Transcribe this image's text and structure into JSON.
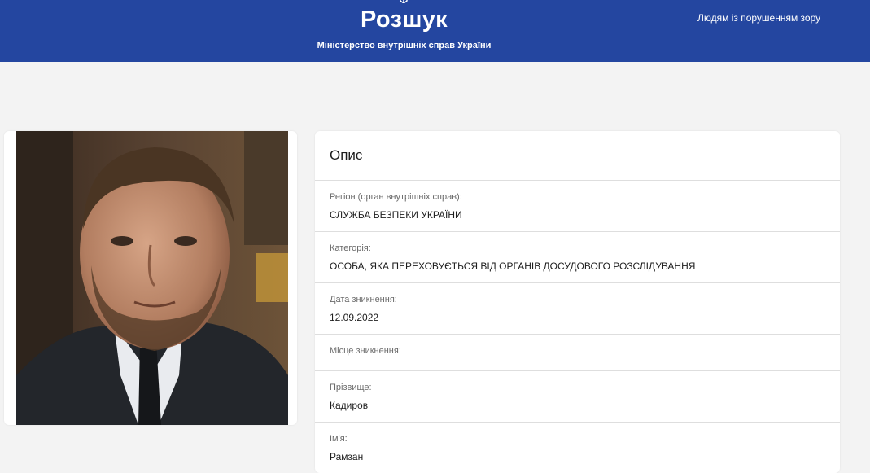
{
  "header": {
    "title": "Розшук",
    "subtitle": "Міністерство внутрішніх справ України",
    "accessibility_link": "Людям із порушенням зору",
    "emblem_icon": "trident-emblem-icon",
    "background_color": "#2446a0"
  },
  "details": {
    "heading": "Опис",
    "fields": [
      {
        "label": "Регіон (орган внутрішніх справ):",
        "value": "СЛУЖБА БЕЗПЕКИ УКРАЇНИ"
      },
      {
        "label": "Категорія:",
        "value": "ОСОБА, ЯКА ПЕРЕХОВУЄТЬСЯ ВІД ОРГАНІВ ДОСУДОВОГО РОЗСЛІДУВАННЯ"
      },
      {
        "label": "Дата зникнення:",
        "value": "12.09.2022"
      },
      {
        "label": "Місце зникнення:",
        "value": ""
      },
      {
        "label": "Прізвище:",
        "value": "Кадиров"
      },
      {
        "label": "Ім'я:",
        "value": "Рамзан"
      }
    ]
  }
}
